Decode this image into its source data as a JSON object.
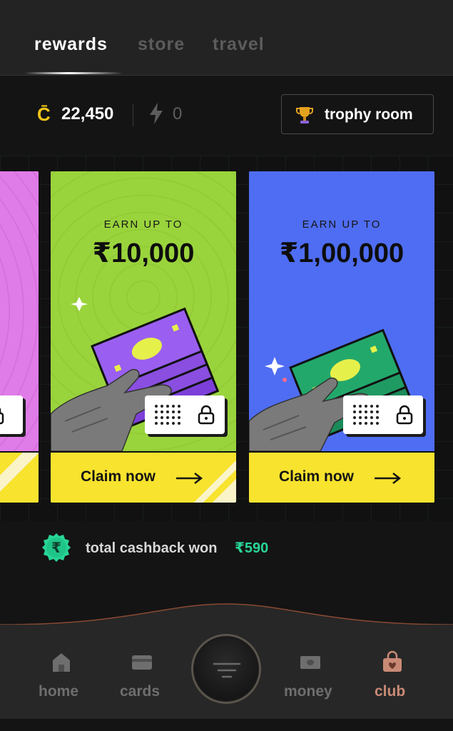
{
  "tabs": [
    {
      "label": "rewards",
      "active": true
    },
    {
      "label": "store",
      "active": false
    },
    {
      "label": "travel",
      "active": false
    }
  ],
  "stats": {
    "coins_icon_glyph": "C̄",
    "coins": "22,450",
    "boosts": "0"
  },
  "trophy_room": {
    "label": "trophy room",
    "icon": "trophy-icon"
  },
  "cards": [
    {
      "earn_label": "",
      "amount": "",
      "claim_label": "",
      "bg": "#e07ce8",
      "partial": true
    },
    {
      "earn_label": "EARN UP TO",
      "amount": "₹10,000",
      "claim_label": "Claim now",
      "bg": "#9ad43c",
      "cash_color": "#8a4ee0"
    },
    {
      "earn_label": "EARN UP TO",
      "amount": "₹1,00,000",
      "claim_label": "Claim now",
      "bg": "#4f6df2",
      "cash_color": "#1f9a62"
    }
  ],
  "cashback": {
    "label": "total cashback won",
    "value": "₹590",
    "icon": "rupee-badge-icon"
  },
  "nav": [
    {
      "label": "home",
      "icon": "home-icon",
      "active": false
    },
    {
      "label": "cards",
      "icon": "card-icon",
      "active": false
    },
    {
      "label": "money",
      "icon": "money-icon",
      "active": false
    },
    {
      "label": "club",
      "icon": "club-bag-icon",
      "active": true
    }
  ],
  "colors": {
    "accent_yellow": "#f8e32e",
    "cashback_green": "#28d596",
    "active_nav": "#c98a75",
    "coin_gold": "#f5c518"
  }
}
